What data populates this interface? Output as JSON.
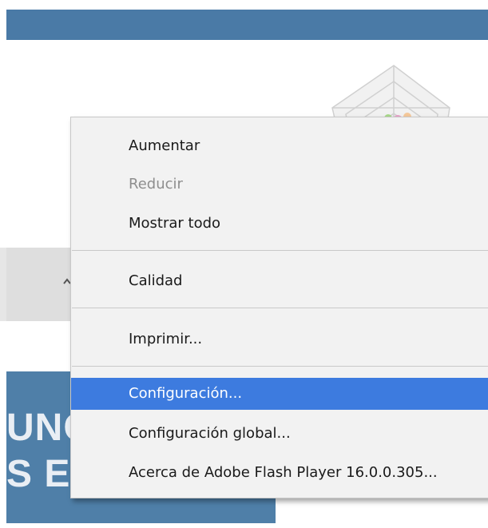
{
  "background": {
    "banner_text_line1": "UNC",
    "banner_text_line2": "S E-I"
  },
  "context_menu": {
    "items": [
      {
        "label": "Aumentar",
        "enabled": true
      },
      {
        "label": "Reducir",
        "enabled": false
      },
      {
        "label": "Mostrar todo",
        "enabled": true
      },
      {
        "label": "Calidad",
        "enabled": true
      },
      {
        "label": "Imprimir...",
        "enabled": true
      },
      {
        "label": "Configuración...",
        "enabled": true,
        "highlighted": true
      },
      {
        "label": "Configuración global...",
        "enabled": true
      },
      {
        "label": "Acerca de Adobe Flash Player 16.0.0.305...",
        "enabled": true
      }
    ]
  },
  "colors": {
    "header_blue": "#4a7aa6",
    "panel_blue": "#4f7fa8",
    "highlight": "#3d7bdf",
    "menu_bg": "#f2f2f2"
  }
}
